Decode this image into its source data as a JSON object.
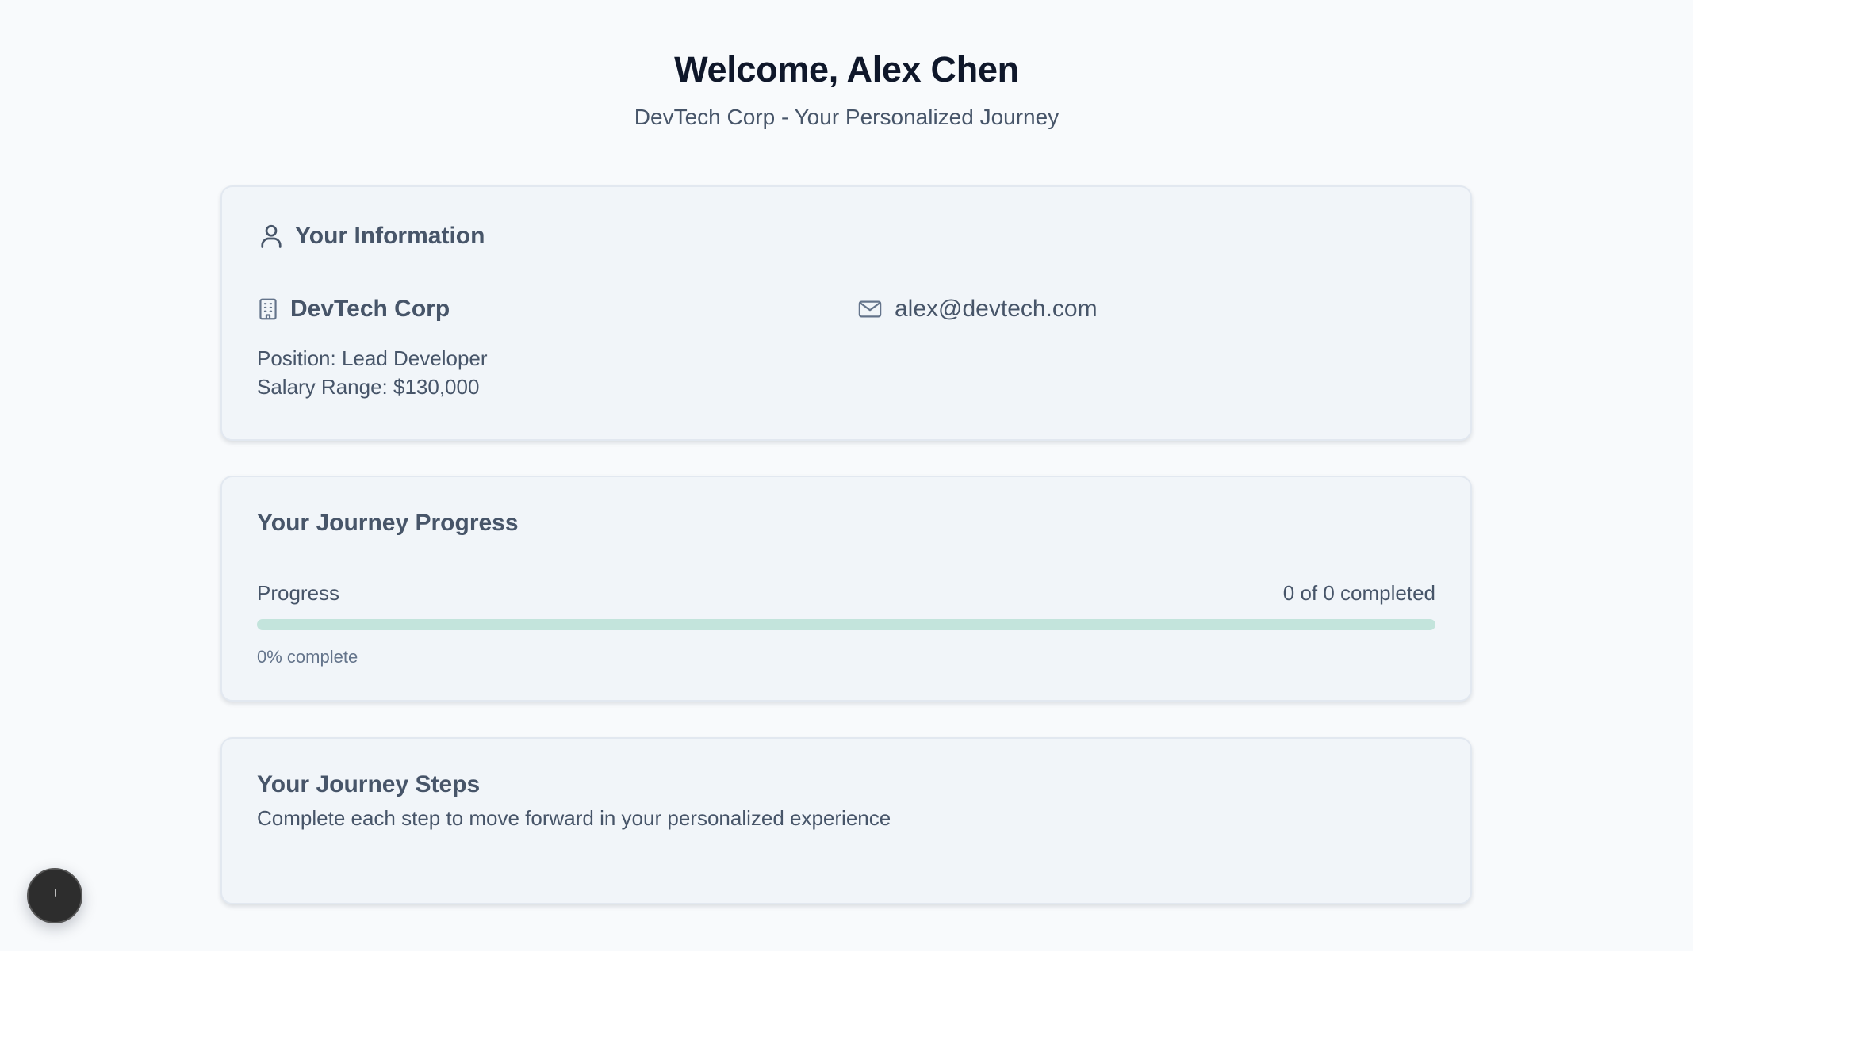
{
  "header": {
    "title": "Welcome, Alex Chen",
    "subtitle": "DevTech Corp - Your Personalized Journey"
  },
  "info_card": {
    "heading": "Your Information",
    "heading_icon": "user-icon",
    "company": "DevTech Corp",
    "company_icon": "building-icon",
    "email": "alex@devtech.com",
    "email_icon": "mail-icon",
    "position": "Position: Lead Developer",
    "salary": "Salary Range: $130,000"
  },
  "progress_card": {
    "heading": "Your Journey Progress",
    "label": "Progress",
    "count": "0 of 0 completed",
    "percent_text": "0% complete",
    "progress_fraction": 0
  },
  "steps_card": {
    "heading": "Your Journey Steps",
    "description": "Complete each step to move forward in your personalized experience"
  },
  "colors": {
    "page_background": "#f8fafc",
    "card_background": "#f1f5f9",
    "title_text": "#0f172a",
    "body_text": "#475569",
    "progress_track": "#c3e4dc",
    "fab_background": "#2d2d2d"
  }
}
